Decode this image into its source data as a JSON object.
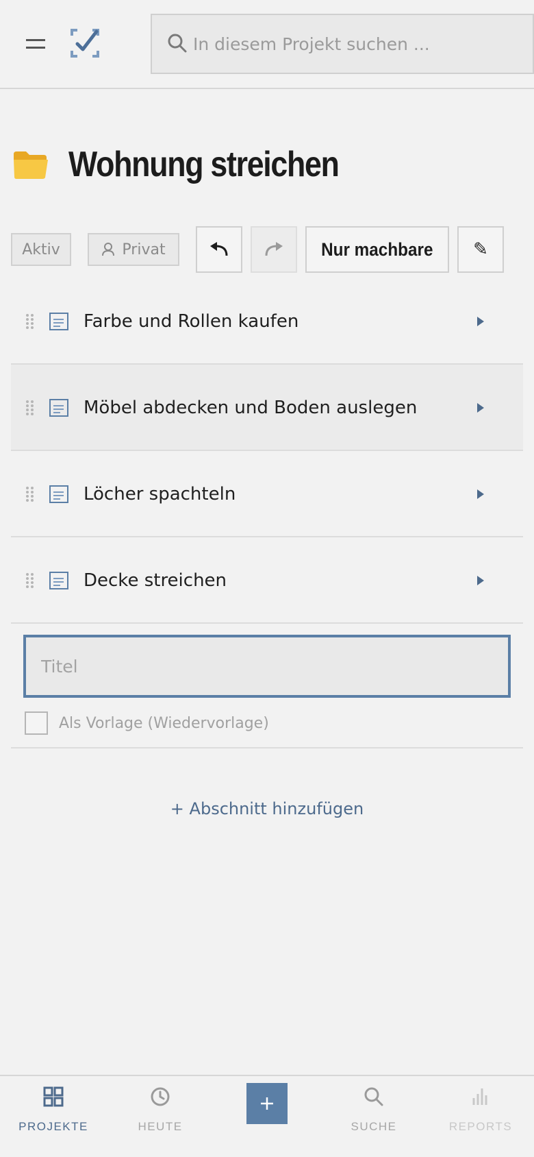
{
  "header": {
    "search_placeholder": "In diesem Projekt suchen ..."
  },
  "project": {
    "title": "Wohnung streichen",
    "icon": "folder-icon"
  },
  "toolbar": {
    "status_label": "Aktiv",
    "visibility_label": "Privat",
    "undo_icon": "undo-icon",
    "redo_icon": "redo-icon",
    "filter_label": "Nur machbare",
    "edit_icon": "pencil-icon"
  },
  "tasks": [
    {
      "label": "Farbe und Rollen kaufen"
    },
    {
      "label": "Möbel abdecken und Boden auslegen"
    },
    {
      "label": "Löcher spachteln"
    },
    {
      "label": "Decke streichen"
    }
  ],
  "new_task": {
    "title_placeholder": "Titel",
    "template_label": "Als Vorlage (Wiedervorlage)"
  },
  "add_section_label": "+ Abschnitt hinzufügen",
  "bottom_nav": {
    "items": [
      {
        "label": "PROJEKTE",
        "icon": "grid-icon",
        "active": true
      },
      {
        "label": "HEUTE",
        "icon": "clock-icon"
      },
      {
        "label": "",
        "icon": "plus-icon"
      },
      {
        "label": "SUCHE",
        "icon": "search-icon"
      },
      {
        "label": "REPORTS",
        "icon": "bar-chart-icon",
        "disabled": true
      }
    ]
  },
  "colors": {
    "accent": "#5b7fa6",
    "background": "#f2f2f2",
    "link": "#4d6a8c"
  }
}
